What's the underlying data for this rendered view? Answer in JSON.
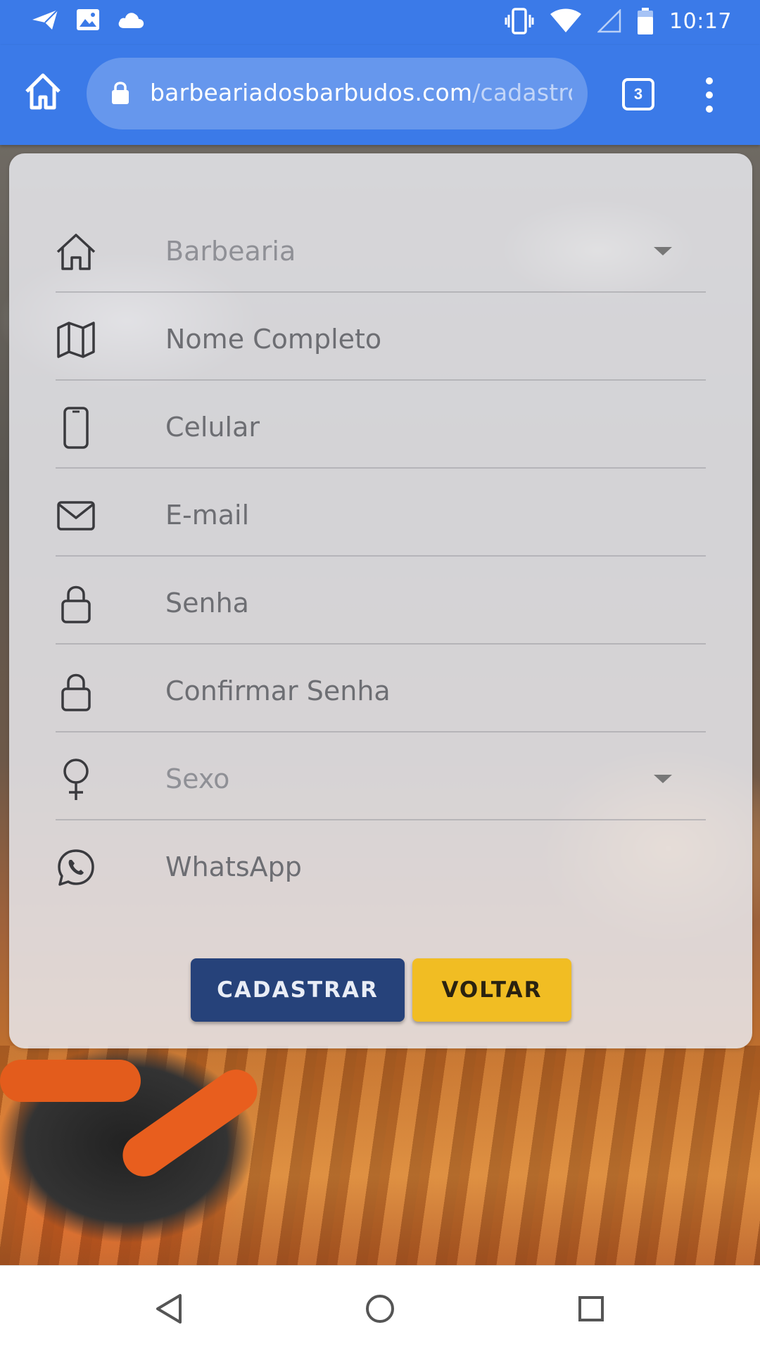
{
  "status_bar": {
    "time": "10:17",
    "left_icons": [
      "send-icon",
      "image-icon",
      "cloud-icon"
    ],
    "right_icons": [
      "vibrate-icon",
      "wifi-icon",
      "signal-icon",
      "battery-icon"
    ]
  },
  "browser": {
    "url_domain": "barbeariadosbarbudos.com",
    "url_path": "/cadastro-u",
    "tab_count": "3",
    "accent_color": "#3b7ae8"
  },
  "form": {
    "fields": [
      {
        "label": "Barbearia",
        "icon": "home-icon",
        "type": "select"
      },
      {
        "label": "Nome Completo",
        "icon": "map-icon",
        "type": "text"
      },
      {
        "label": "Celular",
        "icon": "phone-icon",
        "type": "text"
      },
      {
        "label": "E-mail",
        "icon": "mail-icon",
        "type": "text"
      },
      {
        "label": "Senha",
        "icon": "lock-icon",
        "type": "password"
      },
      {
        "label": "Confirmar Senha",
        "icon": "lock-icon",
        "type": "password"
      },
      {
        "label": "Sexo",
        "icon": "female-icon",
        "type": "select"
      },
      {
        "label": "WhatsApp",
        "icon": "whatsapp-icon",
        "type": "text"
      }
    ],
    "buttons": {
      "register_label": "CADASTRAR",
      "back_label": "VOLTAR",
      "register_color": "#26427a",
      "back_color": "#f1bd23"
    }
  },
  "nav_bar": {
    "icons": [
      "back-triangle-icon",
      "home-circle-icon",
      "recents-square-icon"
    ]
  }
}
